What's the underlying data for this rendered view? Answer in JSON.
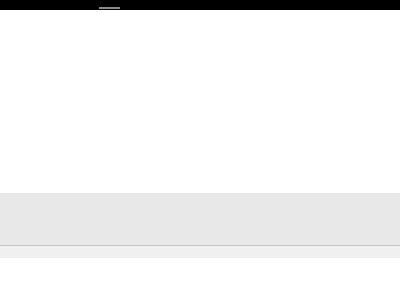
{
  "colors": {
    "top_bar": "#000000",
    "tab_indicator": "#8a8a8a",
    "background": "#ffffff",
    "grey_band": "#e8e8e8",
    "divider": "#c4c4c4",
    "lower_band": "#f0f0f0"
  }
}
